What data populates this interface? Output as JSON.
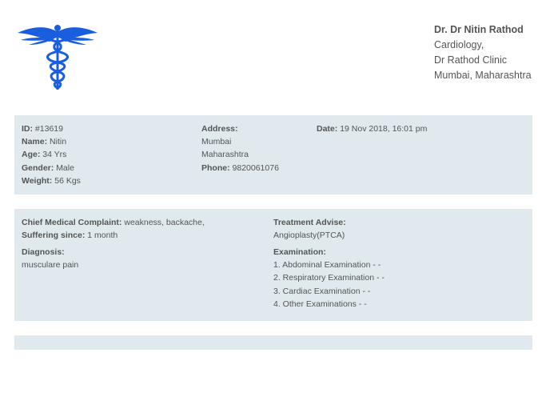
{
  "logo": {
    "icon": "caduceus-icon",
    "color": "#1a5ee0"
  },
  "doctor": {
    "name": "Dr. Dr Nitin Rathod",
    "specialty": "Cardiology,",
    "clinic": "Dr Rathod Clinic",
    "location": "Mumbai, Maharashtra"
  },
  "patient": {
    "id_label": "ID:",
    "id_value": "#13619",
    "name_label": "Name:",
    "name_value": "Nitin",
    "age_label": "Age:",
    "age_value": "34 Yrs",
    "gender_label": "Gender:",
    "gender_value": "Male",
    "weight_label": "Weight:",
    "weight_value": "56 Kgs",
    "address_label": "Address:",
    "address_line1": "Mumbai",
    "address_line2": "Maharashtra",
    "phone_label": "Phone:",
    "phone_value": "9820061076",
    "date_label": "Date:",
    "date_value": "19 Nov 2018, 16:01 pm"
  },
  "clinical": {
    "complaint_label": "Chief Medical Complaint:",
    "complaint_value": "weakness, backache,",
    "suffering_label": "Suffering since:",
    "suffering_value": "1 month",
    "diagnosis_label": "Diagnosis:",
    "diagnosis_value": "musculare pain",
    "treatment_label": "Treatment Advise:",
    "treatment_value": "Angioplasty(PTCA)",
    "examination_label": "Examination:",
    "examinations": [
      "1. Abdominal Examination - -",
      "2. Respiratory Examination - -",
      "3. Cardiac Examination - -",
      "4. Other Examinations - -"
    ]
  },
  "colors": {
    "panel_bg": "#dfe9ee",
    "text": "#555555",
    "logo": "#1a5ee0"
  }
}
